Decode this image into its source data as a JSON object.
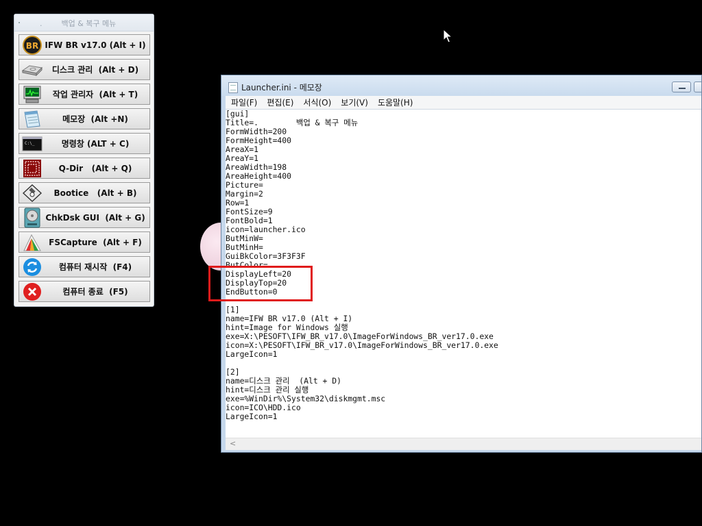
{
  "launcher": {
    "title": ".        백업 & 복구 메뉴",
    "buttons": [
      {
        "label": "IFW BR v17.0 (Alt + I)",
        "icon": "br-logo-icon"
      },
      {
        "label": "디스크 관리  (Alt + D)",
        "icon": "disk-drive-icon"
      },
      {
        "label": "작업 관리자  (Alt + T)",
        "icon": "task-manager-icon"
      },
      {
        "label": "메모장  (Alt +N)",
        "icon": "notepad-icon"
      },
      {
        "label": "명령창 (ALT + C)",
        "icon": "command-prompt-icon"
      },
      {
        "label": "Q-Dir   (Alt + Q)",
        "icon": "qdir-icon"
      },
      {
        "label": "Bootice   (Alt + B)",
        "icon": "floppy-tool-icon"
      },
      {
        "label": "ChkDsk GUI  (Alt + G)",
        "icon": "chkdsk-icon"
      },
      {
        "label": "FSCapture  (Alt + F)",
        "icon": "fscapture-icon"
      },
      {
        "label": "컴퓨터 재시작  (F4)",
        "icon": "restart-icon"
      },
      {
        "label": "컴퓨터 종료  (F5)",
        "icon": "shutdown-icon"
      }
    ]
  },
  "notepad": {
    "title": "Launcher.ini - 메모장",
    "menu": {
      "file": "파일(F)",
      "edit": "편집(E)",
      "format": "서식(O)",
      "view": "보기(V)",
      "help": "도움말(H)"
    },
    "content": "[gui]\nTitle=.        백업 & 복구 메뉴\nFormWidth=200\nFormHeight=400\nAreaX=1\nAreaY=1\nAreaWidth=198\nAreaHeight=400\nPicture=\nMargin=2\nRow=1\nFontSize=9\nFontBold=1\nicon=launcher.ico\nButMinW=\nButMinH=\nGuiBkColor=3F3F3F\nButColor=\nDisplayLeft=20\nDisplayTop=20\nEndButton=0\n\n[1]\nname=IFW BR v17.0 (Alt + I)\nhint=Image for Windows 실행\nexe=X:\\PESOFT\\IFW_BR_v17.0\\ImageForWindows_BR_ver17.0.exe\nicon=X:\\PESOFT\\IFW_BR_v17.0\\ImageForWindows_BR_ver17.0.exe\nLargeIcon=1\n\n[2]\nname=디스크 관리  (Alt + D)\nhint=디스크 관리 실행\nexe=%WinDir%\\System32\\diskmgmt.msc\nicon=ICO\\HDD.ico\nLargeIcon=1",
    "scroll_left_arrow": "<"
  },
  "colors": {
    "highlight": "#e01b1b",
    "desktop": "#000000"
  }
}
